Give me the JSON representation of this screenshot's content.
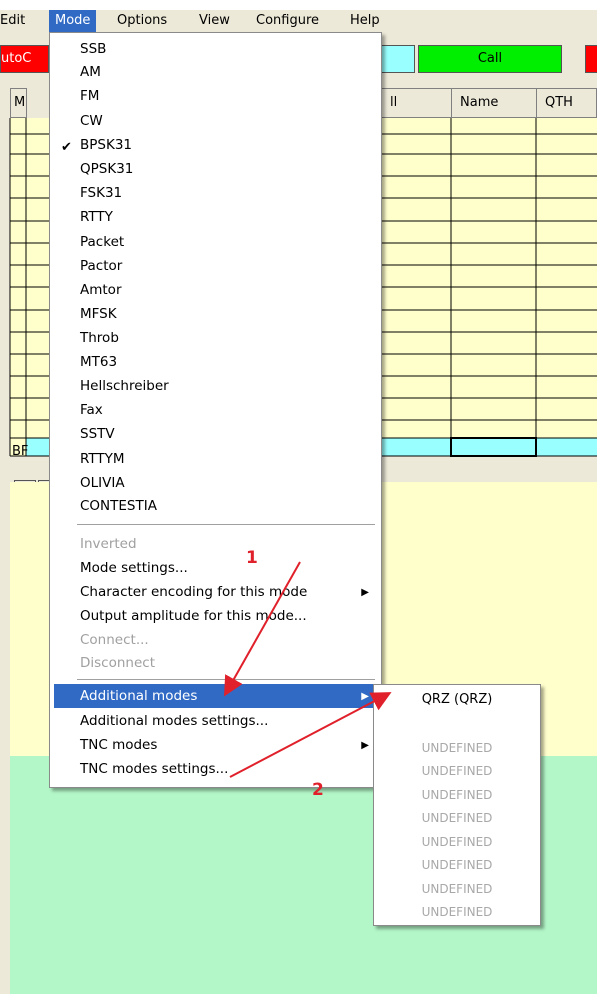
{
  "menubar": {
    "items": [
      "Edit",
      "Mode",
      "Options",
      "View",
      "Configure",
      "Help"
    ],
    "active": "Mode"
  },
  "toolbar": {
    "autocq_label": "utoC",
    "call_label": "Call"
  },
  "grid": {
    "headers": [
      "M",
      "ll",
      "Name",
      "QTH"
    ],
    "selected_row_mode": "BF"
  },
  "mode_menu": {
    "modes": [
      "SSB",
      "AM",
      "FM",
      "CW",
      "BPSK31",
      "QPSK31",
      "FSK31",
      "RTTY",
      "Packet",
      "Pactor",
      "Amtor",
      "MFSK",
      "Throb",
      "MT63",
      "Hellschreiber",
      "Fax",
      "SSTV",
      "RTTYM",
      "OLIVIA",
      "CONTESTIA"
    ],
    "checked": "BPSK31",
    "inverted": "Inverted",
    "mode_settings": "Mode settings...",
    "char_encoding": "Character encoding for this mode",
    "output_amplitude": "Output amplitude for this mode...",
    "connect": "Connect...",
    "disconnect": "Disconnect",
    "additional_modes": "Additional modes",
    "additional_modes_settings": "Additional modes settings...",
    "tnc_modes": "TNC modes",
    "tnc_modes_settings": "TNC modes settings..."
  },
  "submenu": {
    "items": [
      "QRZ (QRZ)",
      "UNDEFINED",
      "UNDEFINED",
      "UNDEFINED",
      "UNDEFINED",
      "UNDEFINED",
      "UNDEFINED",
      "UNDEFINED",
      "UNDEFINED"
    ]
  },
  "annotations": {
    "one": "1",
    "two": "2"
  },
  "colors": {
    "menu_highlight": "#316ac5",
    "annotation_red": "#e0202a",
    "grid_yellow": "#ffffcc",
    "grid_cyan": "#99ffff",
    "panel_green": "#b3f7c8",
    "call_green": "#00ee00",
    "btn_red": "#ff0000"
  }
}
